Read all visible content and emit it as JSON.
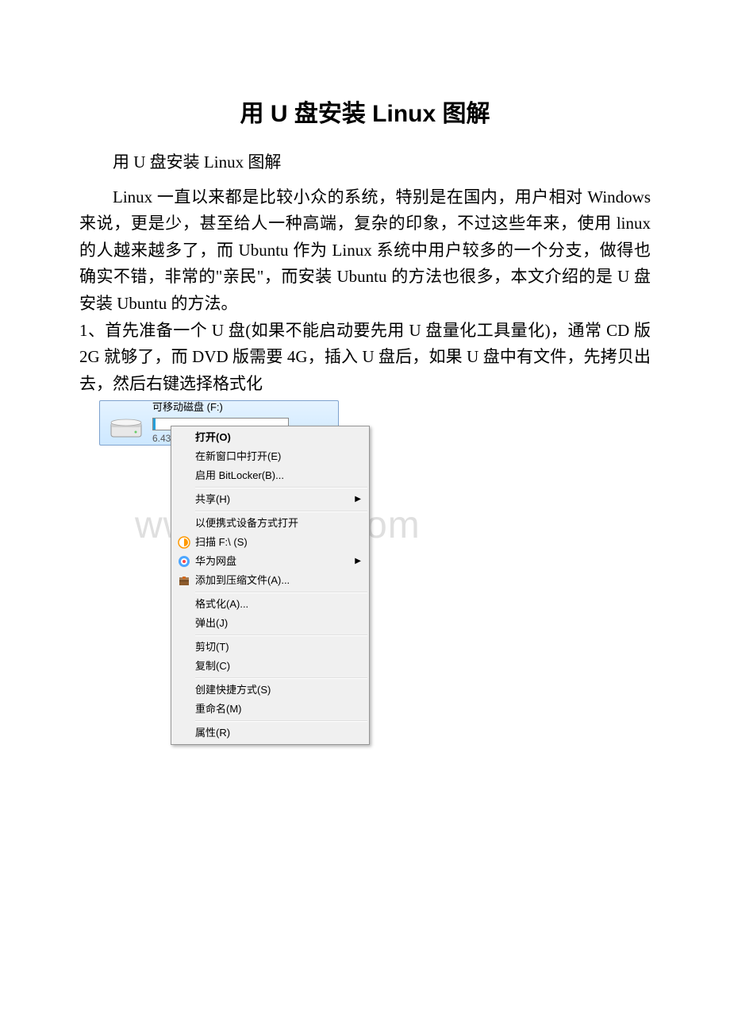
{
  "title": "用 U 盘安装 Linux 图解",
  "subtitle": "用 U 盘安装 Linux 图解",
  "para1_a": "Linux 一直以来都是比较小众的系统，特别是在国内，用户相对 Windows 来说，更是少，甚至给人一种高端，复杂的印象，不过这些年来，使用 linux 的人越来越多了，而 Ubuntu 作为 Linux 系统中用户较多的一个分支，做得也确实不错，非常的\"亲民\"，而安装 Ubuntu 的方法也很多，本文介绍的是 U 盘安装 Ubuntu 的方法。",
  "para2": "1、首先准备一个 U 盘(如果不能启动要先用 U 盘量化工具量化)，通常 CD 版 2G 就够了，而 DVD 版需要 4G，插入 U 盘后，如果 U 盘中有文件，先拷贝出去，然后右键选择格式化",
  "drive": {
    "label": "可移动磁盘 (F:)",
    "freespace": "6.43 G"
  },
  "menu": {
    "open": "打开(O)",
    "open_new": "在新窗口中打开(E)",
    "bitlocker": "启用 BitLocker(B)...",
    "share": "共享(H)",
    "portable": "以便携式设备方式打开",
    "scan": "扫描 F:\\ (S)",
    "huawei": "华为网盘",
    "compress": "添加到压缩文件(A)...",
    "format": "格式化(A)...",
    "eject": "弹出(J)",
    "cut": "剪切(T)",
    "copy": "复制(C)",
    "shortcut": "创建快捷方式(S)",
    "rename": "重命名(M)",
    "properties": "属性(R)"
  },
  "watermark": "www.bdocx.com"
}
